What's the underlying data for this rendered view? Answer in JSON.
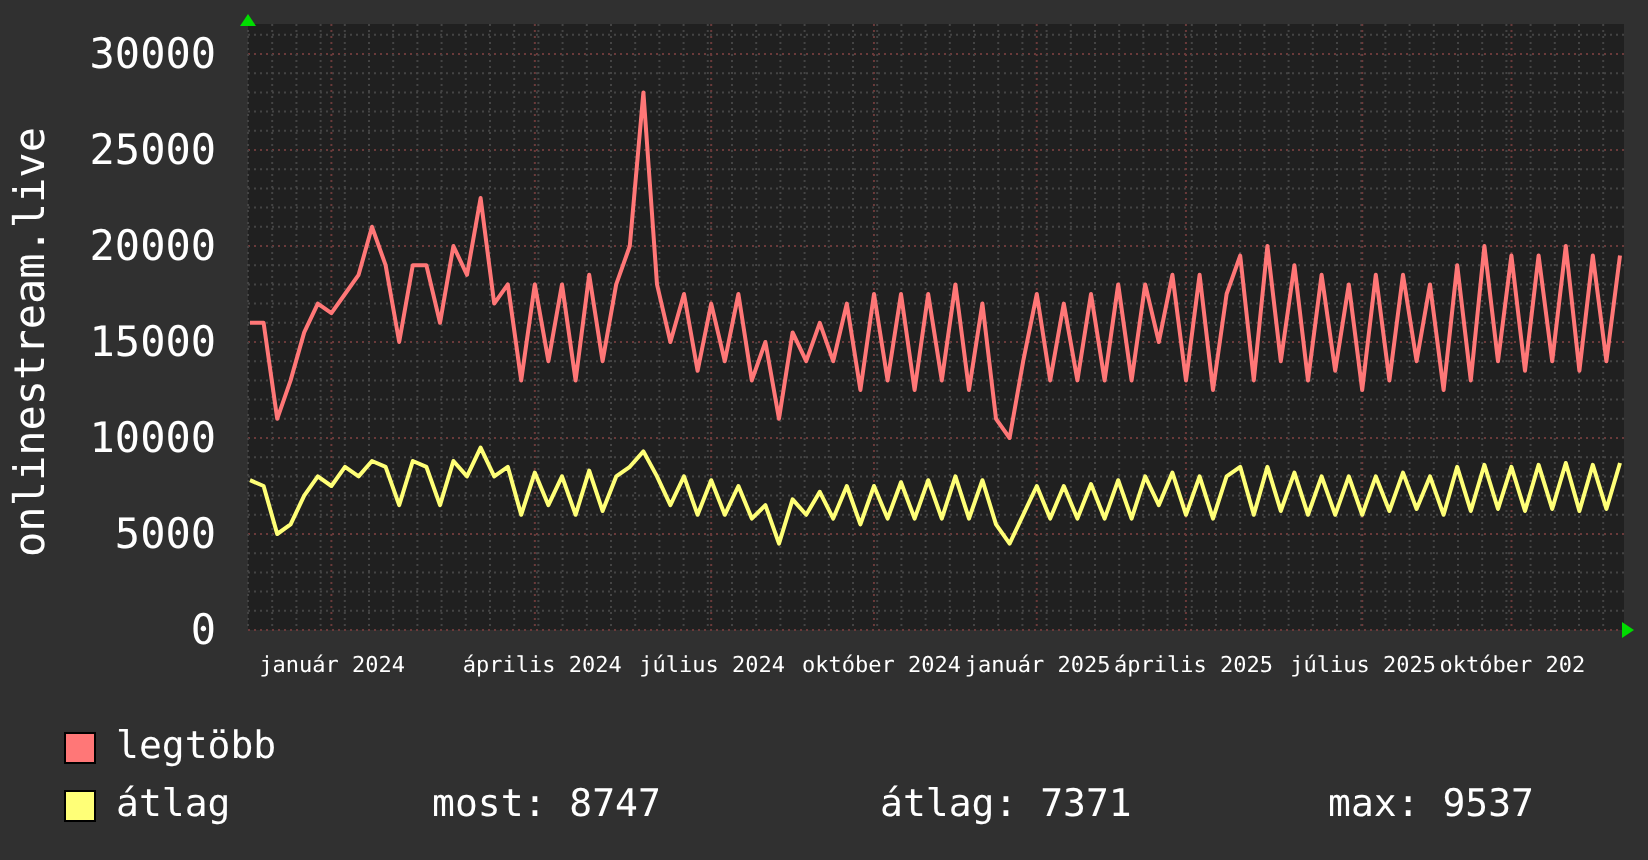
{
  "chart_data": {
    "type": "line",
    "ylabel": "onlinestream.live",
    "categories": [
      null,
      null,
      null,
      null,
      null,
      null,
      "január 2024",
      null,
      null,
      null,
      null,
      null,
      null,
      null,
      null,
      null,
      null,
      null,
      null,
      null,
      null,
      "április 2024",
      null,
      null,
      null,
      null,
      null,
      null,
      null,
      null,
      null,
      null,
      null,
      null,
      "július 2024",
      null,
      null,
      null,
      null,
      null,
      null,
      null,
      null,
      null,
      null,
      null,
      "október 2024",
      null,
      null,
      null,
      null,
      null,
      null,
      null,
      null,
      null,
      null,
      null,
      "január 2025",
      null,
      null,
      null,
      null,
      null,
      null,
      null,
      null,
      null,
      null,
      "április 2025",
      null,
      null,
      null,
      null,
      null,
      null,
      null,
      null,
      null,
      null,
      null,
      null,
      "július 2025",
      null,
      null,
      null,
      null,
      null,
      null,
      null,
      null,
      null,
      null,
      "október 202",
      null,
      null,
      null,
      null,
      null,
      null,
      null,
      null
    ],
    "series": [
      {
        "name": "legtöbb",
        "color": "#ff7777",
        "values": [
          16000,
          16000,
          11000,
          13000,
          15500,
          17000,
          16500,
          17500,
          18500,
          21000,
          19000,
          15000,
          19000,
          19000,
          16000,
          20000,
          18500,
          22500,
          17000,
          18000,
          13000,
          18000,
          14000,
          18000,
          13000,
          18500,
          14000,
          18000,
          20000,
          28000,
          18000,
          15000,
          17500,
          13500,
          17000,
          14000,
          17500,
          13000,
          15000,
          11000,
          15500,
          14000,
          16000,
          14000,
          17000,
          12500,
          17500,
          13000,
          17500,
          12500,
          17500,
          13000,
          18000,
          12500,
          17000,
          11000,
          10000,
          14000,
          17500,
          13000,
          17000,
          13000,
          17500,
          13000,
          18000,
          13000,
          18000,
          15000,
          18500,
          13000,
          18500,
          12500,
          17500,
          19500,
          13000,
          20000,
          14000,
          19000,
          13000,
          18500,
          13500,
          18000,
          12500,
          18500,
          13000,
          18500,
          14000,
          18000,
          12500,
          19000,
          13000,
          20000,
          14000,
          19500,
          13500,
          19500,
          14000,
          20000,
          13500,
          19500,
          14000,
          19500
        ]
      },
      {
        "name": "átlag",
        "color": "#ffff77",
        "values": [
          7800,
          7500,
          5000,
          5500,
          7000,
          8000,
          7500,
          8500,
          8000,
          8800,
          8500,
          6500,
          8800,
          8500,
          6500,
          8800,
          8000,
          9500,
          8000,
          8500,
          6000,
          8200,
          6500,
          8000,
          6000,
          8300,
          6200,
          8000,
          8500,
          9300,
          8000,
          6500,
          8000,
          6000,
          7800,
          6000,
          7500,
          5800,
          6500,
          4500,
          6800,
          6000,
          7200,
          5800,
          7500,
          5500,
          7500,
          5800,
          7700,
          5800,
          7800,
          5800,
          8000,
          5800,
          7800,
          5500,
          4500,
          6000,
          7500,
          5800,
          7500,
          5800,
          7600,
          5800,
          7800,
          5800,
          8000,
          6500,
          8200,
          6000,
          8000,
          5800,
          8000,
          8500,
          6000,
          8500,
          6200,
          8200,
          6000,
          8000,
          6000,
          8000,
          6000,
          8000,
          6200,
          8200,
          6300,
          8000,
          6000,
          8500,
          6200,
          8600,
          6300,
          8500,
          6200,
          8600,
          6300,
          8700,
          6200,
          8600,
          6300,
          8700
        ]
      }
    ],
    "grid": true,
    "ylim": [
      0,
      30000
    ],
    "yticks": [
      0,
      5000,
      10000,
      15000,
      20000,
      25000,
      30000
    ]
  },
  "legend_stats": [
    "most: 8747",
    "átlag: 7371",
    "max: 9537"
  ]
}
